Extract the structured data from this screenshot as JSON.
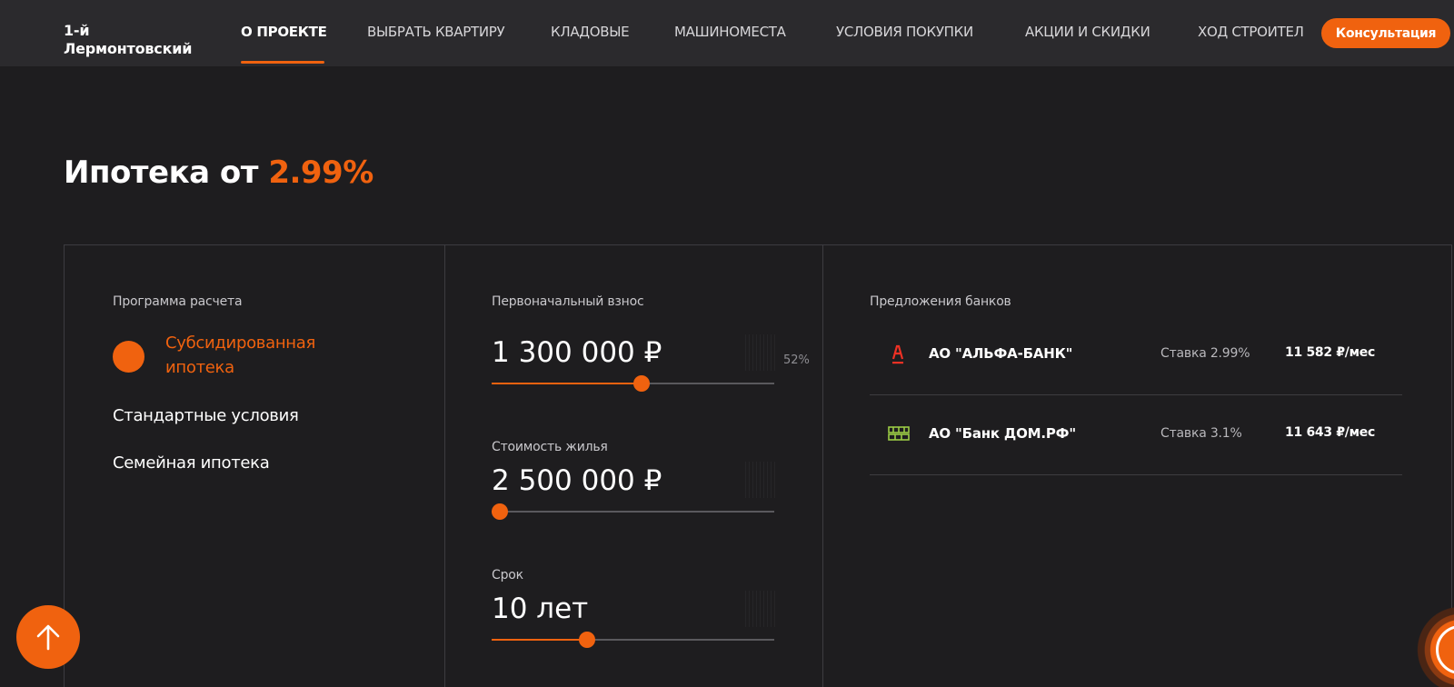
{
  "header": {
    "logo": "1-й\nЛермонтовский",
    "nav": [
      {
        "label": "О ПРОЕКТЕ",
        "active": true
      },
      {
        "label": "ВЫБРАТЬ КВАРТИРУ",
        "active": false
      },
      {
        "label": "КЛАДОВЫЕ",
        "active": false
      },
      {
        "label": "МАШИНОМЕСТА",
        "active": false
      },
      {
        "label": "УСЛОВИЯ ПОКУПКИ",
        "active": false
      },
      {
        "label": "АКЦИИ И СКИДКИ",
        "active": false
      },
      {
        "label": "ХОД СТРОИТЕЛ",
        "active": false
      }
    ],
    "cta": "Консультация"
  },
  "title": {
    "prefix": "Ипотека от ",
    "rate": "2.99%"
  },
  "programs": {
    "label": "Программа расчета",
    "active": "Субсидированная ипотека",
    "items": [
      "Стандартные условия",
      "Семейная ипотека"
    ]
  },
  "sliders": {
    "down_payment": {
      "label": "Первоначальный взнос",
      "value": "1 300 000 ₽",
      "percent": "52%",
      "position": 0.5
    },
    "price": {
      "label": "Стоимость жилья",
      "value": "2 500 000 ₽",
      "position": 0.0
    },
    "term": {
      "label": "Срок",
      "value": "10 лет",
      "position": 0.31
    }
  },
  "banks": {
    "label": "Предложения банков",
    "items": [
      {
        "name": "АО \"АЛЬФА-БАНК\"",
        "rate": "Ставка 2.99%",
        "payment": "11 582 ₽/мес",
        "icon": "alfa-bank-logo-icon",
        "color": "#ef3124"
      },
      {
        "name": "АО \"Банк ДОМ.РФ\"",
        "rate": "Ставка 3.1%",
        "payment": "11 643 ₽/мес",
        "icon": "dom-rf-logo-icon",
        "color": "#9ccc45"
      }
    ]
  },
  "colors": {
    "accent": "#f0620f",
    "background": "#1e1d1f",
    "header": "#2b2a2d"
  }
}
